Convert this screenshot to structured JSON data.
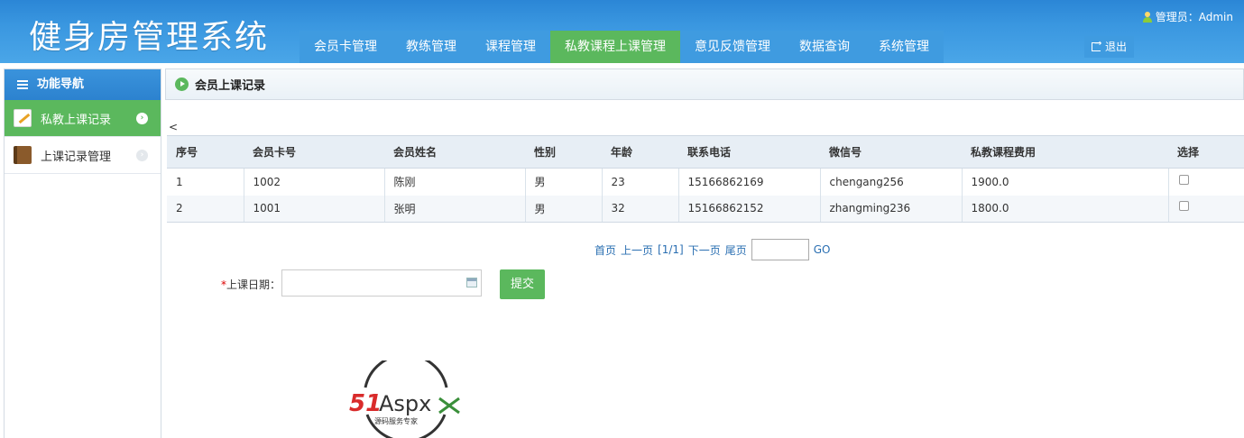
{
  "header": {
    "title": "健身房管理系统",
    "nav": [
      "会员卡管理",
      "教练管理",
      "课程管理",
      "私教课程上课管理",
      "意见反馈管理",
      "数据查询",
      "系统管理"
    ],
    "active_nav_index": 3,
    "user": "管理员：Admin",
    "logout": "退出"
  },
  "sidebar": {
    "title": "功能导航",
    "items": [
      {
        "label": "私教上课记录",
        "active": true,
        "icon": "notepad-icon"
      },
      {
        "label": "上课记录管理",
        "active": false,
        "icon": "book-icon"
      }
    ]
  },
  "main": {
    "title": "会员上课记录",
    "stray_char": "<",
    "table": {
      "headers": [
        "序号",
        "会员卡号",
        "会员姓名",
        "性别",
        "年龄",
        "联系电话",
        "微信号",
        "私教课程费用",
        "选择"
      ],
      "rows": [
        [
          "1",
          "1002",
          "陈刚",
          "男",
          "23",
          "15166862169",
          "chengang256",
          "1900.0"
        ],
        [
          "2",
          "1001",
          "张明",
          "男",
          "32",
          "15166862152",
          "zhangming236",
          "1800.0"
        ]
      ]
    },
    "pager": {
      "first": "首页",
      "prev": "上一页",
      "info": "[1/1]",
      "next": "下一页",
      "last": "尾页",
      "go": "GO"
    },
    "form": {
      "required_mark": "*",
      "date_label": "上课日期：",
      "submit": "提交"
    }
  },
  "watermark": {
    "brand": "51Aspx",
    "tagline": "源码服务专家"
  },
  "colors": {
    "header_blue": "#3a97e0",
    "accent_green": "#5bb85d",
    "link_blue": "#2a6fb2"
  }
}
